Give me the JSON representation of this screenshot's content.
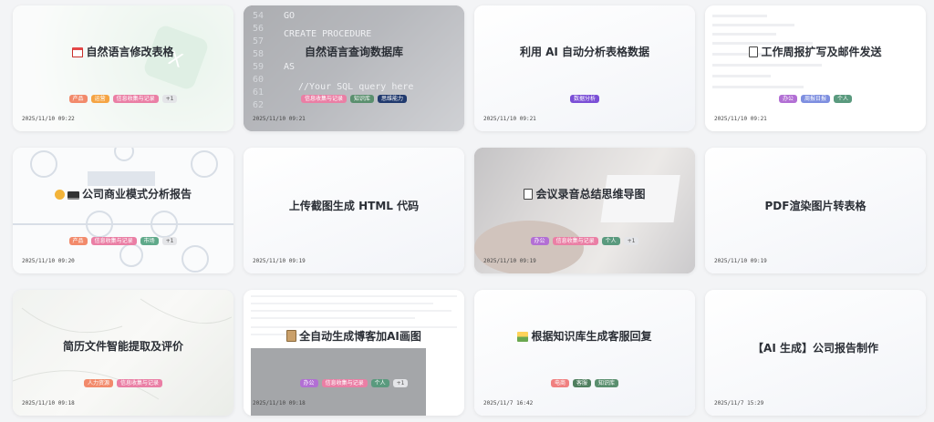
{
  "cards": [
    {
      "title": "自然语言修改表格",
      "icon": "calendar-icon",
      "date": "2025/11/10 09:22",
      "tags": [
        {
          "label": "产品",
          "color": "#f28a6b"
        },
        {
          "label": "运营",
          "color": "#f5a443"
        },
        {
          "label": "信息收集与记录",
          "color": "#ea7fa5"
        }
      ],
      "more": "+1"
    },
    {
      "title": "自然语言查询数据库",
      "icon": "",
      "date": "2025/11/10 09:21",
      "tags": [
        {
          "label": "信息收集与记录",
          "color": "#ea7fa5"
        },
        {
          "label": "知识库",
          "color": "#5a8f6e"
        },
        {
          "label": "思维能力",
          "color": "#213a6e"
        }
      ],
      "more": ""
    },
    {
      "title": "利用 AI 自动分析表格数据",
      "icon": "",
      "date": "2025/11/10 09:21",
      "tags": [
        {
          "label": "数据分析",
          "color": "#7b4fd6"
        }
      ],
      "more": ""
    },
    {
      "title": "工作周报扩写及邮件发送",
      "icon": "document-icon",
      "date": "2025/11/10 09:21",
      "tags": [
        {
          "label": "办公",
          "color": "#b26fd4"
        },
        {
          "label": "周报日报",
          "color": "#7e8fe0"
        },
        {
          "label": "个人",
          "color": "#5a9a7e"
        }
      ],
      "more": ""
    },
    {
      "title": "公司商业模式分析报告",
      "icon": "face-laptop-icon",
      "date": "2025/11/10 09:20",
      "tags": [
        {
          "label": "产品",
          "color": "#f28a6b"
        },
        {
          "label": "信息收集与记录",
          "color": "#ea7fa5"
        },
        {
          "label": "市场",
          "color": "#5fa98a"
        }
      ],
      "more": "+1"
    },
    {
      "title": "上传截图生成 HTML 代码",
      "icon": "",
      "date": "2025/11/10 09:19",
      "tags": [],
      "more": ""
    },
    {
      "title": "会议录音总结思维导图",
      "icon": "document-icon",
      "date": "2025/11/10 09:19",
      "tags": [
        {
          "label": "办公",
          "color": "#b26fd4"
        },
        {
          "label": "信息收集与记录",
          "color": "#ea7fa5"
        },
        {
          "label": "个人",
          "color": "#5a9a7e"
        }
      ],
      "more": "+1"
    },
    {
      "title": "PDF渲染图片转表格",
      "icon": "",
      "date": "2025/11/10 09:19",
      "tags": [],
      "more": ""
    },
    {
      "title": "简历文件智能提取及评价",
      "icon": "",
      "date": "2025/11/10 09:18",
      "tags": [
        {
          "label": "人力资源",
          "color": "#f28a6b"
        },
        {
          "label": "信息收集与记录",
          "color": "#ea7fa5"
        }
      ],
      "more": ""
    },
    {
      "title": "全自动生成博客加AI画图",
      "icon": "clipboard-icon",
      "date": "2025/11/10 09:18",
      "tags": [
        {
          "label": "办公",
          "color": "#b26fd4"
        },
        {
          "label": "信息收集与记录",
          "color": "#ea7fa5"
        },
        {
          "label": "个人",
          "color": "#5a9a7e"
        }
      ],
      "more": "+1"
    },
    {
      "title": "根据知识库生成客服回复",
      "icon": "picture-icon",
      "date": "2025/11/7 16:42",
      "tags": [
        {
          "label": "电商",
          "color": "#f08080"
        },
        {
          "label": "客服",
          "color": "#4f7f5e"
        },
        {
          "label": "知识库",
          "color": "#5a8f6e"
        }
      ],
      "more": ""
    },
    {
      "title": "【AI 生成】公司报告制作",
      "icon": "",
      "date": "2025/11/7 15:29",
      "tags": [],
      "more": ""
    }
  ]
}
